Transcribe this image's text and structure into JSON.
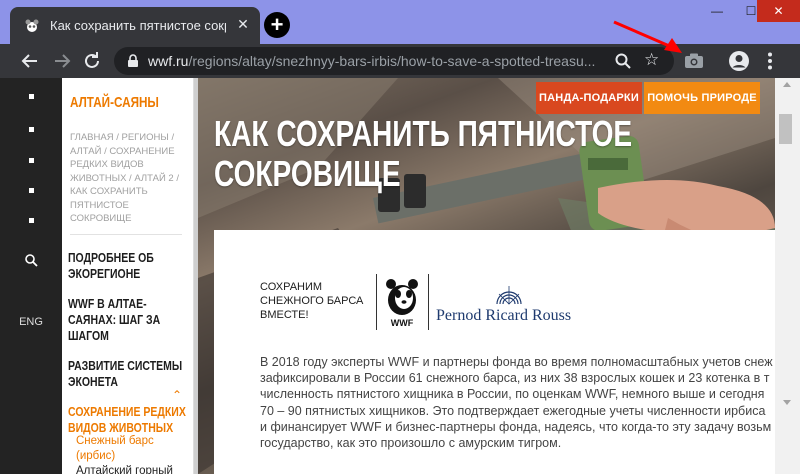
{
  "browser": {
    "tab_title": "Как сохранить пятнистое сокро",
    "tab_close": "✕",
    "new_tab": "+",
    "url_host": "wwf.ru",
    "url_path": "/regions/altay/snezhnyy-bars-irbis/how-to-save-a-spotted-treasu...",
    "window": {
      "minimize": "—",
      "maximize": "☐",
      "close": "✕"
    },
    "annotation_color": "#ff0000",
    "icons": [
      "back-icon",
      "forward-icon",
      "reload-icon",
      "lock-icon",
      "zoom-icon",
      "star-icon",
      "camera-icon",
      "profile-icon",
      "menu-icon"
    ]
  },
  "rail": {
    "lang": "ENG"
  },
  "sidebar": {
    "region_title": "АЛТАЙ-САЯНЫ",
    "breadcrumbs": "ГЛАВНАЯ / РЕГИОНЫ / АЛТАЙ / СОХРАНЕНИЕ РЕДКИХ ВИДОВ ЖИВОТНЫХ / АЛТАЙ 2 / КАК СОХРАНИТЬ ПЯТНИСТОЕ СОКРОВИЩЕ",
    "nav": [
      {
        "label": "ПОДРОБНЕЕ ОБ ЭКОРЕГИОНЕ"
      },
      {
        "label": "WWF В АЛТАЕ-САЯНАХ: ШАГ ЗА ШАГОМ"
      },
      {
        "label": "РАЗВИТИЕ СИСТЕМЫ ЭКОНЕТА"
      },
      {
        "label": "СОХРАНЕНИЕ РЕДКИХ ВИДОВ ЖИВОТНЫХ"
      }
    ],
    "sub": [
      {
        "label": "Снежный барс (ирбис)"
      },
      {
        "label": "Алтайский горный"
      }
    ]
  },
  "header": {
    "gift_button": "ПАНДА-ПОДАРКИ",
    "help_button": "ПОМОЧЬ ПРИРОДЕ",
    "headline": "КАК СОХРАНИТЬ ПЯТНИСТОЕ СОКРОВИЩЕ"
  },
  "card": {
    "tagline": "СОХРАНИМ СНЕЖНОГО БАРСА ВМЕСТЕ!",
    "wwf": "WWF",
    "partner": "Pernod Ricard Rouss",
    "article_lines": [
      "В 2018 году эксперты WWF и партнеры фонда во время полномасштабных учетов снеж",
      "зафиксировали в России 61 снежного барса, из них 38 взрослых кошек и 23 котенка в т",
      "численность пятнистого хищника в России, по оценкам WWF, немного выше и сегодня",
      "70 – 90 пятнистых хищников. Это подтверждает ежегодные учеты численности ирбиса",
      "и финансирует WWF и бизнес-партнеры фонда, надеясь, что когда-то эту задачу возьм",
      "государство, как это произошло с амурским тигром."
    ]
  },
  "colors": {
    "accent": "#ed7a00",
    "gift": "#d9481f",
    "help": "#f28a12",
    "titlebar": "#8d93e8"
  }
}
